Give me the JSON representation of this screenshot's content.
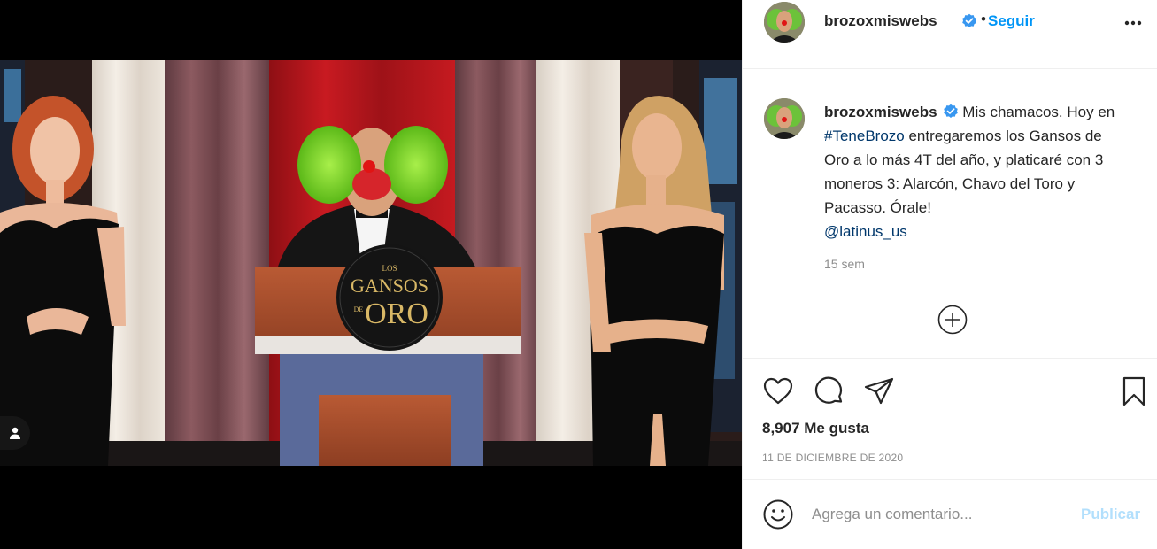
{
  "post": {
    "username": "brozoxmiswebs",
    "verified": true,
    "follow_label": "Seguir",
    "more_icon": "more-horizontal-icon",
    "caption": {
      "username": "brozoxmiswebs",
      "text_1": "Mis chamacos. Hoy en ",
      "hashtag": "#TeneBrozo",
      "text_2": " entregaremos los Gansos de Oro a lo más 4T del año, y platicaré con 3 moneros 3: Alarcón, Chavo del Toro y Pacasso. Órale!",
      "mention": "@latinus_us"
    },
    "time_ago": "15 sem",
    "likes_label": "8,907 Me gusta",
    "date_label": "11 DE DICIEMBRE DE 2020"
  },
  "podium_sign": {
    "line1": "LOS",
    "line2": "GANSOS",
    "line3": "DE",
    "line4": "ORO"
  },
  "icons": {
    "like": "heart-icon",
    "comment": "comment-icon",
    "share": "send-icon",
    "save": "bookmark-icon",
    "load_more": "plus-circle-icon",
    "emoji": "smiley-icon",
    "tag": "user-tag-icon"
  },
  "comment_box": {
    "placeholder": "Agrega un comentario...",
    "publish_label": "Publicar"
  },
  "colors": {
    "link_blue": "#0095f6",
    "hashtag_blue": "#00376b",
    "publish_disabled": "#b2dffc",
    "verified_blue": "#3897f0",
    "curtain_red": "#b3161c",
    "wig_green": "#7ed321"
  }
}
